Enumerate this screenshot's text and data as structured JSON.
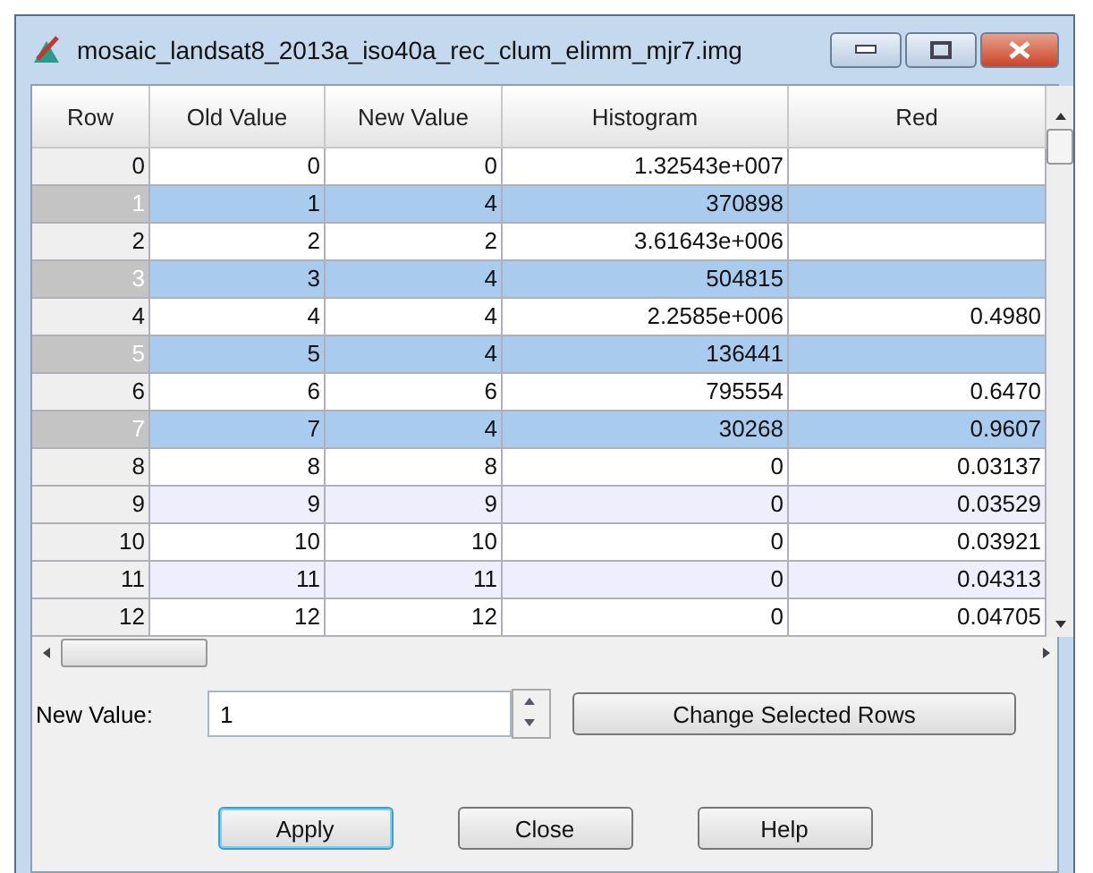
{
  "window": {
    "title": "mosaic_landsat8_2013a_iso40a_rec_clum_elimm_mjr7.img"
  },
  "table": {
    "columns": [
      "Row",
      "Old Value",
      "New Value",
      "Histogram",
      "Red"
    ],
    "rows": [
      {
        "cells": [
          "0",
          "0",
          "0",
          "1.32543e+007",
          ""
        ],
        "selected": false
      },
      {
        "cells": [
          "1",
          "1",
          "4",
          "370898",
          ""
        ],
        "selected": true
      },
      {
        "cells": [
          "2",
          "2",
          "2",
          "3.61643e+006",
          ""
        ],
        "selected": false
      },
      {
        "cells": [
          "3",
          "3",
          "4",
          "504815",
          ""
        ],
        "selected": true
      },
      {
        "cells": [
          "4",
          "4",
          "4",
          "2.2585e+006",
          "0.4980"
        ],
        "selected": false
      },
      {
        "cells": [
          "5",
          "5",
          "4",
          "136441",
          ""
        ],
        "selected": true
      },
      {
        "cells": [
          "6",
          "6",
          "6",
          "795554",
          "0.6470"
        ],
        "selected": false
      },
      {
        "cells": [
          "7",
          "7",
          "4",
          "30268",
          "0.9607"
        ],
        "selected": true
      },
      {
        "cells": [
          "8",
          "8",
          "8",
          "0",
          "0.03137"
        ],
        "selected": false
      },
      {
        "cells": [
          "9",
          "9",
          "9",
          "0",
          "0.03529"
        ],
        "selected": false
      },
      {
        "cells": [
          "10",
          "10",
          "10",
          "0",
          "0.03921"
        ],
        "selected": false
      },
      {
        "cells": [
          "11",
          "11",
          "11",
          "0",
          "0.04313"
        ],
        "selected": false
      },
      {
        "cells": [
          "12",
          "12",
          "12",
          "0",
          "0.04705"
        ],
        "selected": false
      }
    ]
  },
  "new_value": {
    "label": "New Value:",
    "value": "1"
  },
  "change_button": "Change Selected Rows",
  "buttons": [
    {
      "label": "Apply",
      "focused": true
    },
    {
      "label": "Close",
      "focused": false
    },
    {
      "label": "Help",
      "focused": false
    }
  ]
}
